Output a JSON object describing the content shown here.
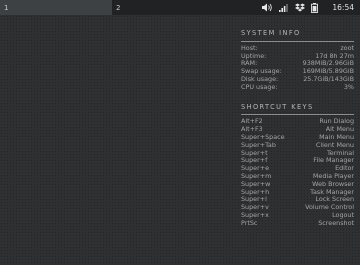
{
  "topbar": {
    "workspaces": [
      {
        "label": "1",
        "active": true
      },
      {
        "label": "2",
        "active": false
      }
    ],
    "tray_icons": [
      "volume-icon",
      "signal-icon",
      "dropbox-icon",
      "battery-icon"
    ],
    "clock": "16:54"
  },
  "system_info": {
    "title": "SYSTEM INFO",
    "rows": [
      {
        "label": "Host:",
        "value": "zoot"
      },
      {
        "label": "Uptime:",
        "value": "17d 8h 27m"
      },
      {
        "label": "RAM:",
        "value": "938MiB/2.96GiB"
      },
      {
        "label": "Swap usage:",
        "value": "169MiB/5.89GiB"
      },
      {
        "label": "Disk usage:",
        "value": "25.7GiB/143GiB"
      },
      {
        "label": "CPU usage:",
        "value": "3%"
      }
    ]
  },
  "shortcut_keys": {
    "title": "SHORTCUT KEYS",
    "rows": [
      {
        "label": "Alt+F2",
        "value": "Run Dialog"
      },
      {
        "label": "Alt+F3",
        "value": "Alt Menu"
      },
      {
        "label": "Super+Space",
        "value": "Main Menu"
      },
      {
        "label": "Super+Tab",
        "value": "Client Menu"
      },
      {
        "label": "Super+t",
        "value": "Terminal"
      },
      {
        "label": "Super+f",
        "value": "File Manager"
      },
      {
        "label": "Super+e",
        "value": "Editor"
      },
      {
        "label": "Super+m",
        "value": "Media Player"
      },
      {
        "label": "Super+w",
        "value": "Web Browser"
      },
      {
        "label": "Super+h",
        "value": "Task Manager"
      },
      {
        "label": "Super+l",
        "value": "Lock Screen"
      },
      {
        "label": "Super+v",
        "value": "Volume Control"
      },
      {
        "label": "Super+x",
        "value": "Logout"
      },
      {
        "label": "PrtSc",
        "value": "Screenshot"
      }
    ]
  }
}
